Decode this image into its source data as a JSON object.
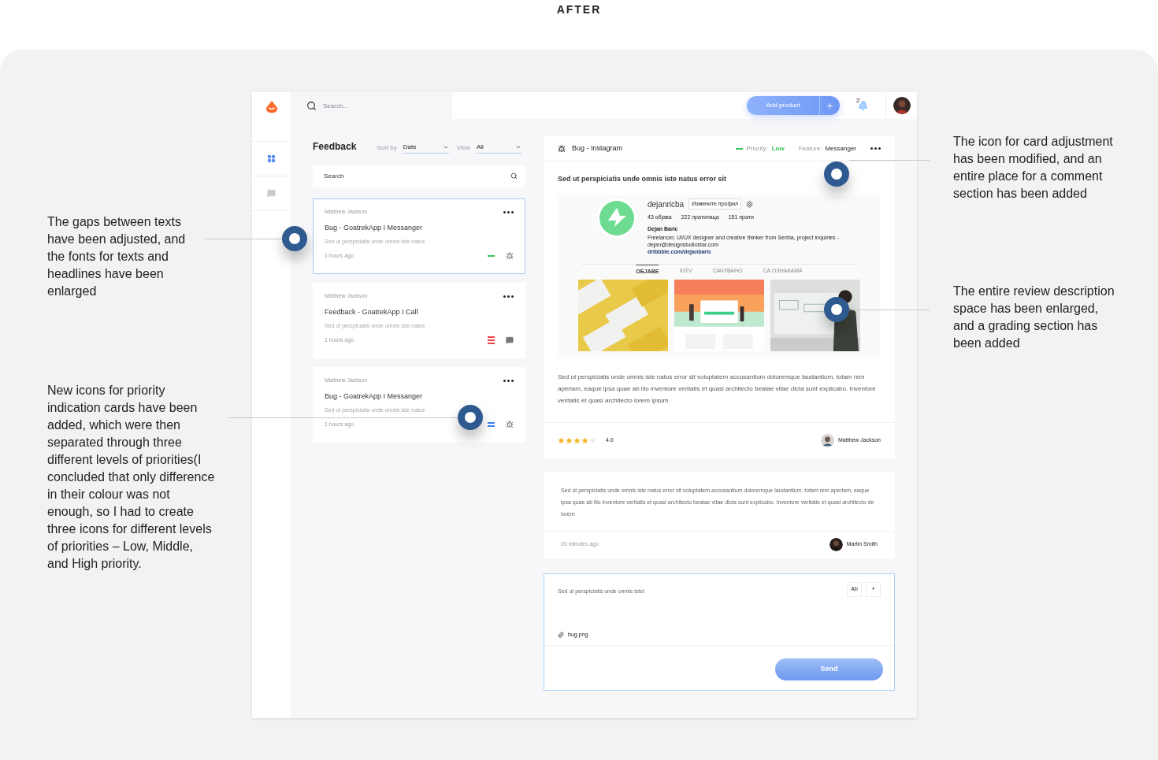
{
  "page_title": "AFTER",
  "annotations_left": [
    {
      "text": "The gaps between texts have been adjusted, and the fonts for texts and headlines have been enlarged"
    },
    {
      "text": "New icons for priority indication cards have been added, which were then separated through three different levels of priorities(I concluded that only difference in their colour was not enough, so I had to create three icons for different levels of priorities – Low, Middle, and High priority."
    }
  ],
  "annotations_right": [
    {
      "text": "The icon for card adjustment has been modified, and an entire place for a comment section has been added"
    },
    {
      "text": "The entire review description space has been enlarged, and a grading section has been added"
    }
  ],
  "sidebar": {
    "items": [
      {
        "kind": "grid",
        "selected": true
      },
      {
        "kind": "chat",
        "selected": false
      }
    ]
  },
  "topbar": {
    "search_placeholder": "Search...",
    "add_button": "Add product",
    "notification_count": "2"
  },
  "feedback": {
    "title": "Feedback",
    "sort_label": "Sort by",
    "sort_value": "Date",
    "view_label": "View",
    "view_value": "All",
    "search_placeholder": "Search",
    "cards": [
      {
        "author": "Matthew Jackson",
        "title": "Bug - GoatrekApp I Messanger",
        "description": "Sed ut perspiciatis unde omnis iste natus",
        "time": "1 hours ago",
        "priority_icon": {
          "kind": "low"
        },
        "kind": "bug",
        "selected": true
      },
      {
        "author": "Matthew Jackson",
        "title": "Feedback - GoatrekApp I Call",
        "description": "Sed ut perspiciatis unde omnis iste natus",
        "time": "1 hours ago",
        "priority_icon": {
          "kind": "high"
        },
        "kind": "feedback",
        "selected": false
      },
      {
        "author": "Matthew Jackson",
        "title": "Bug - GoatrekApp I Messanger",
        "description": "Sed ut perspiciatis unde omnis iste natus",
        "time": "1 hours ago",
        "priority_icon": {
          "kind": "middle"
        },
        "kind": "bug",
        "selected": false
      }
    ]
  },
  "detail": {
    "kind": "bug",
    "title": "Bug - Instagram",
    "priority_icon": {
      "kind": "low"
    },
    "priority_label": "Priority:",
    "priority_value": "Low",
    "feature_label": "Feature:",
    "feature_value": "Messanger",
    "heading": "Sed ut perspiciatis unde omnis iste natus error sit",
    "screenshot": {
      "username": "dejanricba",
      "edit_button": "Измените профил",
      "stats": [
        "43 објава",
        "222 пратилаца",
        "151 прати"
      ],
      "name": "Dejan Baric",
      "bio": "Freelancer, UI/UX designer and creative thinker from Serbia, project inquiries - dejan@designstudiostar.com",
      "link": "dribbble.com/dejanbaric",
      "tabs": [
        {
          "label": "ОБЈАВЕ",
          "selected": true
        },
        {
          "label": "IGTV",
          "selected": false
        },
        {
          "label": "САЧУВАНО",
          "selected": false
        },
        {
          "label": "СА ОЗНАКАМА",
          "selected": false
        }
      ],
      "photos": [
        {
          "kind": "picture"
        },
        {
          "kind": "picture"
        },
        {
          "kind": "picture"
        }
      ]
    },
    "description": "Sed ut perspiciatis unde omnis iste natus error sit voluptatem accusantium doloremque laudantium, totam rem aperiam, eaque ipsa quae ab illo inventore veritatis et quasi architecto beatae vitae dicta sunt explicabo. Inventore veritatis et quasi architecto lorem ipsum",
    "stars": 4,
    "rating": "4.0",
    "author": "Matthew Jackson"
  },
  "comments": [
    {
      "text": "Sed ut perspiciatis unde omnis iste natus error sit voluptatem accusantium doloremque laudantium, totam rem aperiam, eaque ipsa quae ab illo inventore veritatis et quasi architecto beatae vitae dicta sunt explicabo. Inventore veritatis et quasi architecto de lorem",
      "time": "20 minutes ago",
      "author": "Martin Smith"
    }
  ],
  "compose": {
    "value": "Sed ut perspiciatis unde omnis istel",
    "format_button": "Ab",
    "add_button": "+",
    "attachment": "bug.png",
    "send_button": "Send"
  }
}
